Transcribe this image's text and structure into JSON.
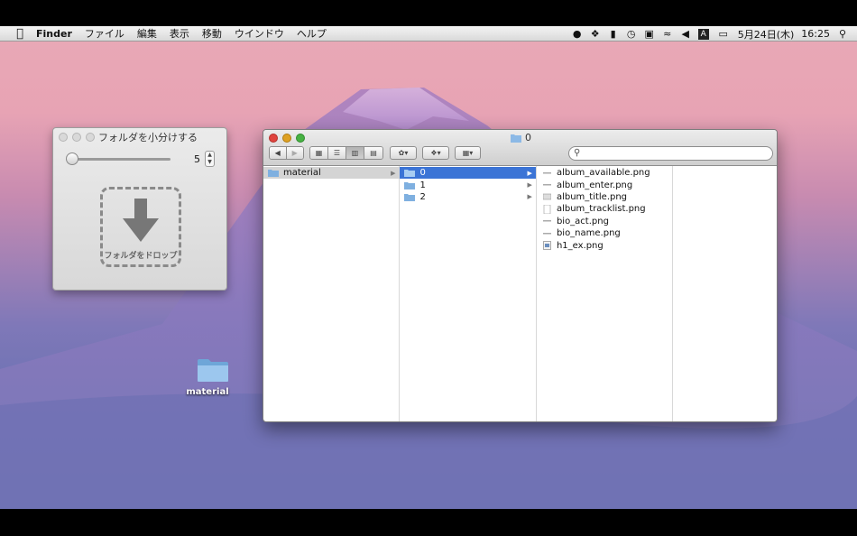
{
  "menubar": {
    "app_name": "Finder",
    "items": [
      "ファイル",
      "編集",
      "表示",
      "移動",
      "ウインドウ",
      "ヘルプ"
    ],
    "clock_date": "5月24日(木)",
    "clock_time": "16:25",
    "status_icons": [
      "cat-icon",
      "dropbox-icon",
      "bookmark-icon",
      "time-machine-icon",
      "display-icon",
      "wifi-icon",
      "volume-icon",
      "input-method-icon",
      "battery-icon",
      "spotlight-icon"
    ]
  },
  "panel": {
    "title": "フォルダを小分けする",
    "slider_value": "5",
    "drop_label": "フォルダをドロップ"
  },
  "desktop": {
    "icon_label": "material"
  },
  "finder": {
    "title": "0",
    "col1": [
      {
        "name": "material",
        "type": "folder",
        "selected": "grey"
      }
    ],
    "col2": [
      {
        "name": "0",
        "type": "folder",
        "selected": "blue"
      },
      {
        "name": "1",
        "type": "folder",
        "selected": ""
      },
      {
        "name": "2",
        "type": "folder",
        "selected": ""
      }
    ],
    "col3": [
      {
        "name": "album_available.png",
        "type": "file"
      },
      {
        "name": "album_enter.png",
        "type": "file"
      },
      {
        "name": "album_title.png",
        "type": "file"
      },
      {
        "name": "album_tracklist.png",
        "type": "file"
      },
      {
        "name": "bio_act.png",
        "type": "file"
      },
      {
        "name": "bio_name.png",
        "type": "file"
      },
      {
        "name": "h1_ex.png",
        "type": "file"
      }
    ]
  },
  "colors": {
    "selection_blue": "#3b74d6",
    "close_red": "#e0443e",
    "minimize_yellow": "#dea123",
    "zoom_green": "#47b243"
  }
}
